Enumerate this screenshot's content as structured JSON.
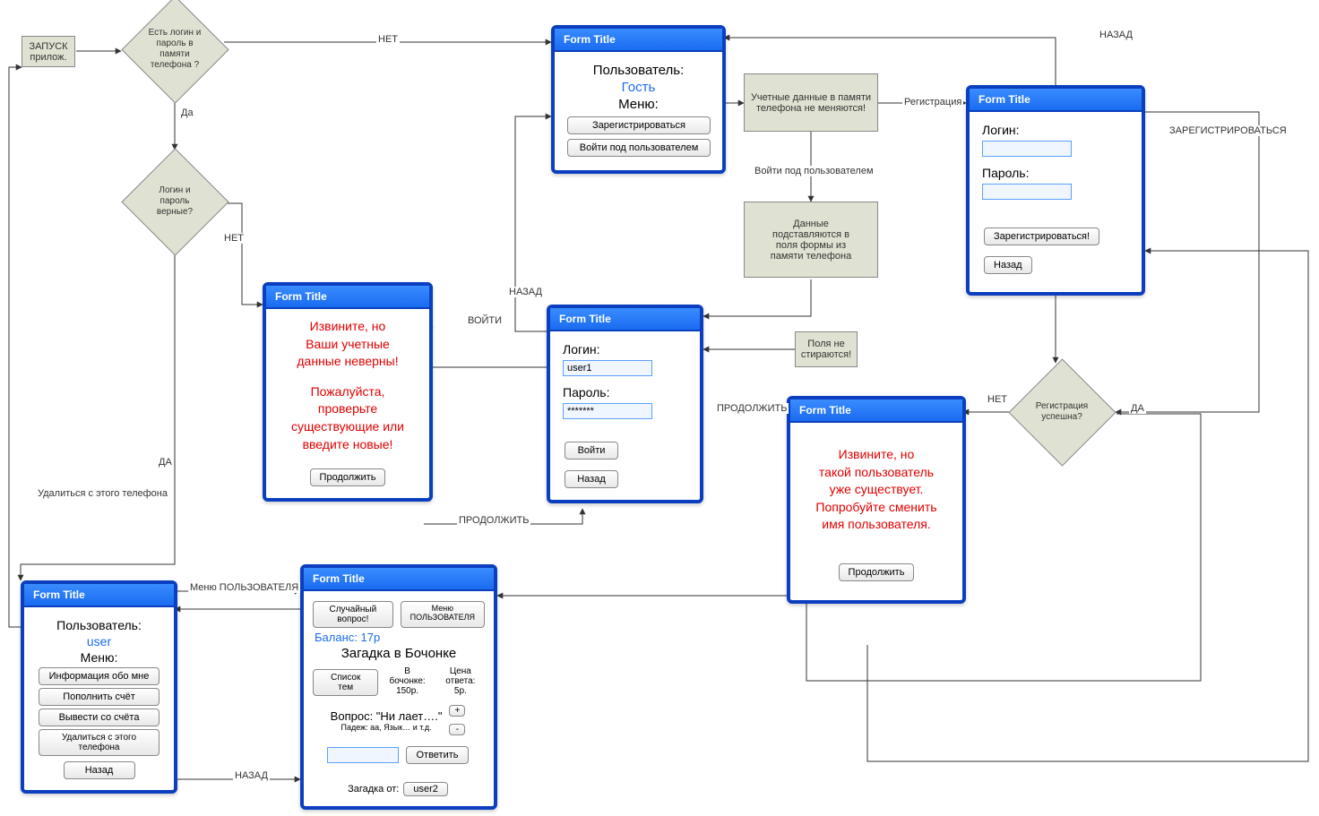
{
  "formTitle": "Form Title",
  "start": {
    "label": "ЗАПУСК\nприлож."
  },
  "decision1": {
    "label": "Есть логин и\nпароль в\nпамяти\nтелефона ?",
    "yes": "Да",
    "no": "НЕТ"
  },
  "decision2": {
    "label": "Логин и\nпароль\nверные?",
    "yes": "ДА",
    "no": "НЕТ"
  },
  "decision3": {
    "label": "Регистрация\nуспешна?",
    "yes": "ДА",
    "no": "НЕТ"
  },
  "process_credsSame": "Учетные данные в памяти\nтелефона не меняются!",
  "process_prefill": "Данные\nподставляются в\nполя формы из\nпамяти телефона",
  "process_noClear": "Поля не\nстираются!",
  "formGuest": {
    "userLabel": "Пользователь:",
    "userName": "Гость",
    "menuLabel": "Меню:",
    "btn_register": "Зарегистрироваться",
    "btn_loginAs": "Войти под пользователем"
  },
  "formError": {
    "line1": "Извините, но\nВаши учетные\nданные неверны!",
    "line2": "Пожалуйста,\nпроверьте\nсуществующие или\nвведите новые!",
    "btn_continue": "Продолжить"
  },
  "formLogin": {
    "loginLabel": "Логин:",
    "loginValue": "user1",
    "passLabel": "Пароль:",
    "passValue": "*******",
    "btn_enter": "Войти",
    "btn_back": "Назад"
  },
  "formRegister": {
    "loginLabel": "Логин:",
    "passLabel": "Пароль:",
    "btn_register": "Зарегистрироваться!",
    "btn_back": "Назад"
  },
  "formUserExists": {
    "text": "Извините, но\nтакой пользователь\nуже существует.\nПопробуйте сменить\nимя пользователя.",
    "btn_continue": "Продолжить"
  },
  "formUserMenu": {
    "userLabel": "Пользователь:",
    "userName": "user",
    "menuLabel": "Меню:",
    "btn_info": "Информация обо мне",
    "btn_topup": "Пополнить счёт",
    "btn_withdraw": "Вывести со счёта",
    "btn_delete": "Удалиться с этого телефона",
    "btn_back": "Назад"
  },
  "formGame": {
    "btn_random": "Случайный вопрос!",
    "btn_userMenu": "Меню\nПОЛЬЗОВАТЕЛЯ",
    "balance": "Баланс: 17р",
    "title": "Загадка в Бочонке",
    "btn_topics": "Список тем",
    "inBarrelLabel": "В бочонке:",
    "inBarrelValue": "150р.",
    "answerCostLabel": "Цена ответа:",
    "answerCostValue": "5р.",
    "questionLabel": "Вопрос: \"Ни лает….\"",
    "hints": "Падеж: аа, Язык… и т.д.",
    "btn_plus": "+",
    "btn_minus": "-",
    "btn_answer": "Ответить",
    "riddleFrom": "Загадка от:",
    "riddleAuthor": "user2"
  },
  "edges": {
    "no": "НЕТ",
    "yes": "Да",
    "yesUpper": "ДА",
    "back": "НАЗАД",
    "registration": "Регистрация",
    "loginAsUser": "Войти под пользователем",
    "registerAction": "ЗАРЕГИСТРИРОВАТЬСЯ",
    "enter": "ВОЙТИ",
    "continue": "ПРОДОЛЖИТЬ",
    "deleteFromPhone": "Удалиться с этого телефона",
    "menuUser": "Меню ПОЛЬЗОВАТЕЛЯ",
    "backLower": "НАЗАД"
  }
}
